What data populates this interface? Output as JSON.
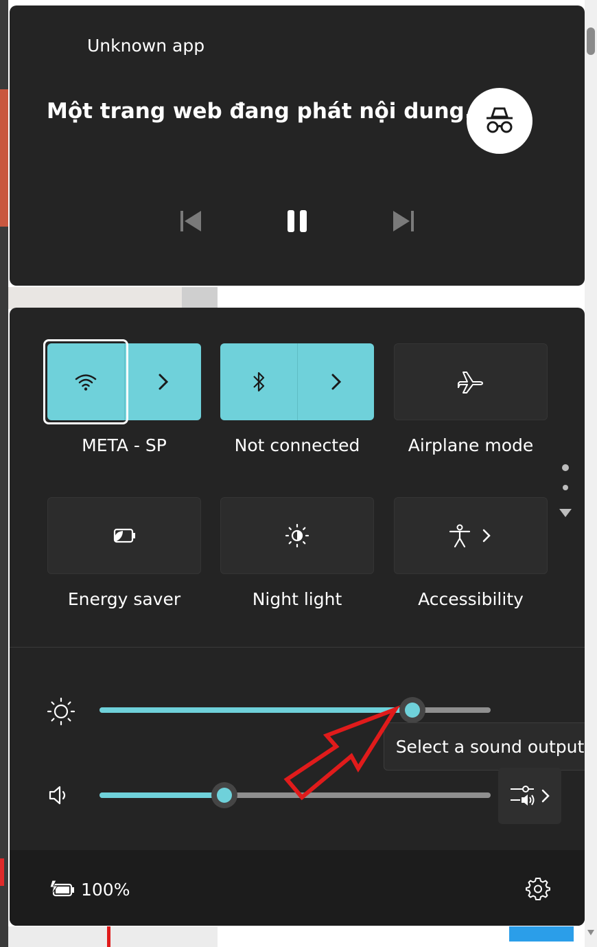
{
  "media": {
    "app_name": "Unknown app",
    "title": "Một trang web đang phát nội dung...",
    "avatar_icon": "incognito-icon",
    "controls": [
      "previous-icon",
      "pause-icon",
      "next-icon"
    ]
  },
  "quick_settings": {
    "tiles": [
      {
        "label": "META - SP",
        "icon": "wifi-icon",
        "active": true,
        "has_arrow": true
      },
      {
        "label": "Not connected",
        "icon": "bluetooth-icon",
        "active": true,
        "has_arrow": true
      },
      {
        "label": "Airplane mode",
        "icon": "airplane-icon",
        "active": false,
        "has_arrow": false
      },
      {
        "label": "Energy saver",
        "icon": "energy-saver-icon",
        "active": false,
        "has_arrow": false
      },
      {
        "label": "Night light",
        "icon": "night-light-icon",
        "active": false,
        "has_arrow": false
      },
      {
        "label": "Accessibility",
        "icon": "accessibility-icon",
        "active": false,
        "has_arrow": true
      }
    ],
    "brightness": {
      "icon": "brightness-icon",
      "level_percent": 80
    },
    "volume": {
      "icon": "speaker-icon",
      "level_percent": 32
    },
    "tooltip": "Select a sound output",
    "sound_output_icon": "sound-output-icon"
  },
  "footer": {
    "battery_icon": "battery-charging-icon",
    "battery_text": "100%",
    "settings_icon": "gear-icon"
  },
  "colors": {
    "accent": "#6fd1da",
    "panel": "#242424",
    "footer": "#1c1c1c",
    "annotation_arrow": "#e01b1b"
  }
}
